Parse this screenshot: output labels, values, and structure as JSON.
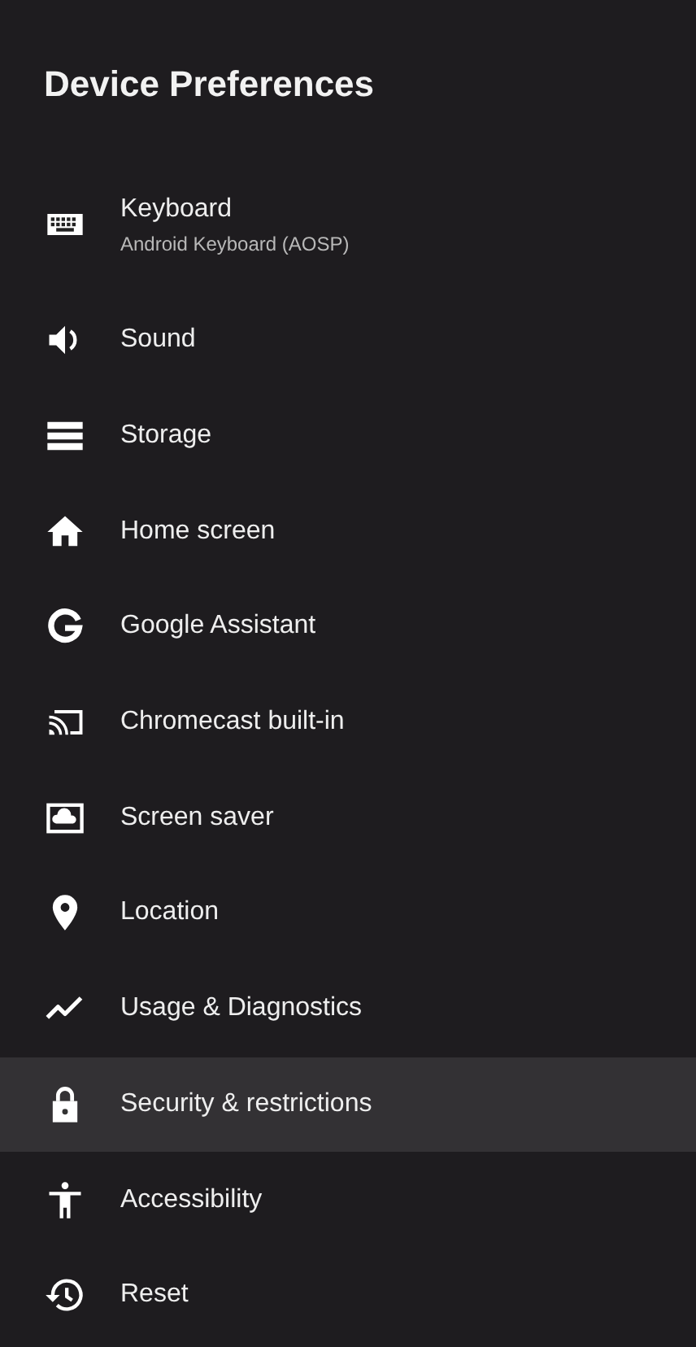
{
  "title": "Device Preferences",
  "items": [
    {
      "label": "Keyboard",
      "subtitle": "Android Keyboard (AOSP)",
      "selected": false
    },
    {
      "label": "Sound",
      "selected": false
    },
    {
      "label": "Storage",
      "selected": false
    },
    {
      "label": "Home screen",
      "selected": false
    },
    {
      "label": "Google Assistant",
      "selected": false
    },
    {
      "label": "Chromecast built-in",
      "selected": false
    },
    {
      "label": "Screen saver",
      "selected": false
    },
    {
      "label": "Location",
      "selected": false
    },
    {
      "label": "Usage & Diagnostics",
      "selected": false
    },
    {
      "label": "Security & restrictions",
      "selected": true
    },
    {
      "label": "Accessibility",
      "selected": false
    },
    {
      "label": "Reset",
      "selected": false
    }
  ]
}
